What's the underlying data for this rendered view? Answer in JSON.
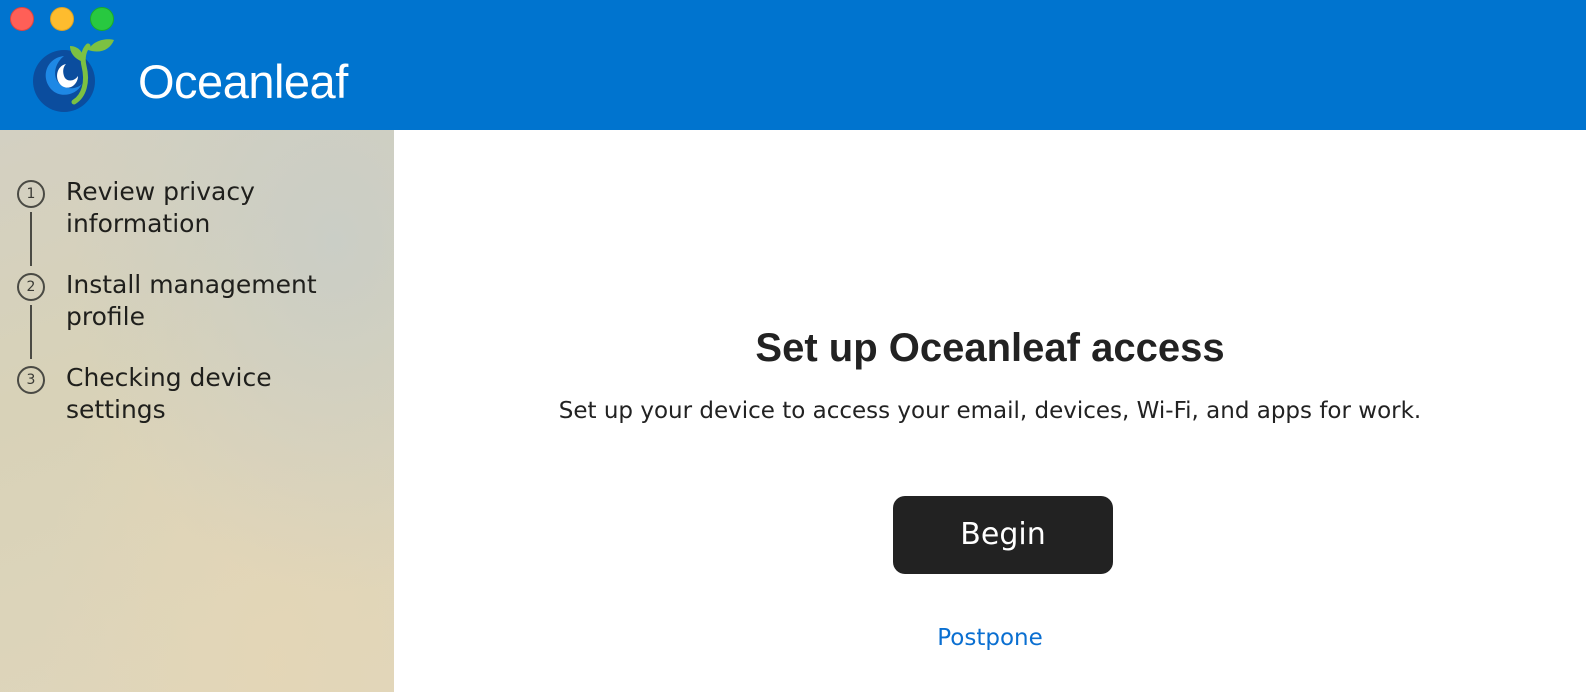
{
  "header": {
    "app_name": "Oceanleaf",
    "logo_icon": "oceanleaf-logo-icon",
    "background_color": "#0074cf"
  },
  "window_controls": {
    "close_color": "#ff5f57",
    "minimize_color": "#febc2e",
    "maximize_color": "#28c840"
  },
  "sidebar": {
    "steps": [
      {
        "number": "1",
        "label": "Review privacy information"
      },
      {
        "number": "2",
        "label": "Install management profile"
      },
      {
        "number": "3",
        "label": "Checking device settings"
      }
    ]
  },
  "main": {
    "title": "Set up Oceanleaf access",
    "subtitle": "Set up your device to access your email, devices, Wi-Fi, and apps for work.",
    "begin_label": "Begin",
    "postpone_label": "Postpone",
    "link_color": "#0a6fd1"
  }
}
